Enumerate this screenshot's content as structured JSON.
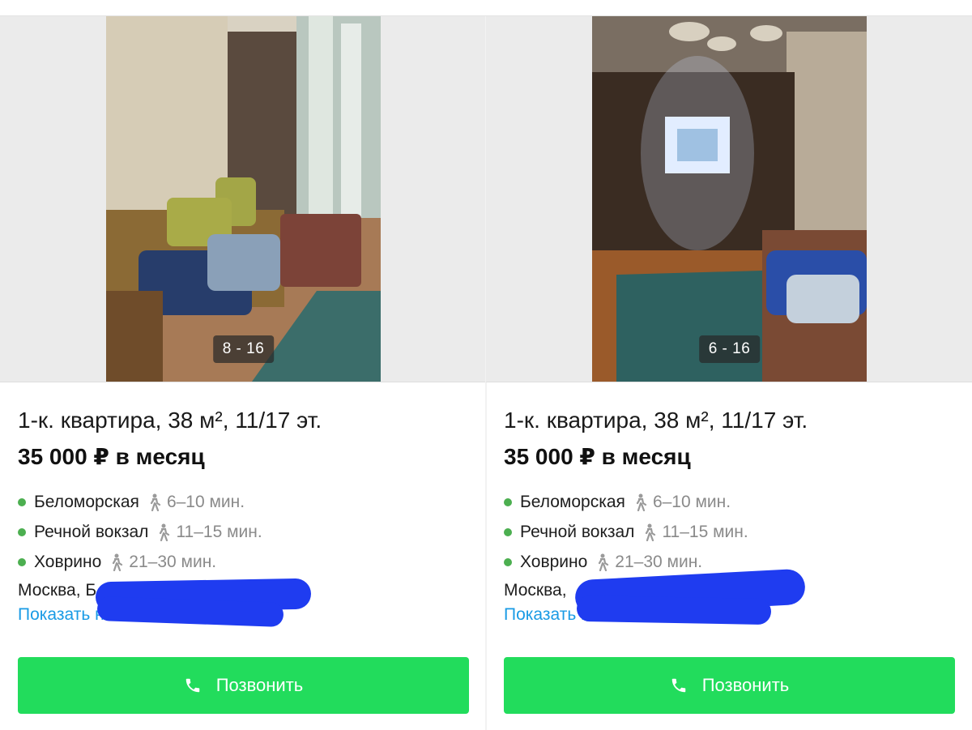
{
  "colors": {
    "accent_green": "#22dc5c",
    "metro_dot": "#4caf50",
    "link_blue": "#1a9be5",
    "redaction_blue": "#1f3cf0"
  },
  "listings": [
    {
      "photo_counter": "8 - 16",
      "title": "1-к. квартира, 38 м², 11/17 эт.",
      "price": "35 000 ₽ в месяц",
      "metro": [
        {
          "station": "Беломорская",
          "time": "6–10 мин."
        },
        {
          "station": "Речной вокзал",
          "time": "11–15 мин."
        },
        {
          "station": "Ховрино",
          "time": "21–30 мин."
        }
      ],
      "address": "Москва, Б",
      "map_link": "Показать на",
      "call_label": "Позвонить"
    },
    {
      "photo_counter": "6 - 16",
      "title": "1-к. квартира, 38 м², 11/17 эт.",
      "price": "35 000 ₽ в месяц",
      "metro": [
        {
          "station": "Беломорская",
          "time": "6–10 мин."
        },
        {
          "station": "Речной вокзал",
          "time": "11–15 мин."
        },
        {
          "station": "Ховрино",
          "time": "21–30 мин."
        }
      ],
      "address": "Москва,",
      "map_link": "Показать на",
      "call_label": "Позвонить"
    }
  ],
  "icons": {
    "walk": "walking-person-icon",
    "phone": "phone-icon"
  }
}
